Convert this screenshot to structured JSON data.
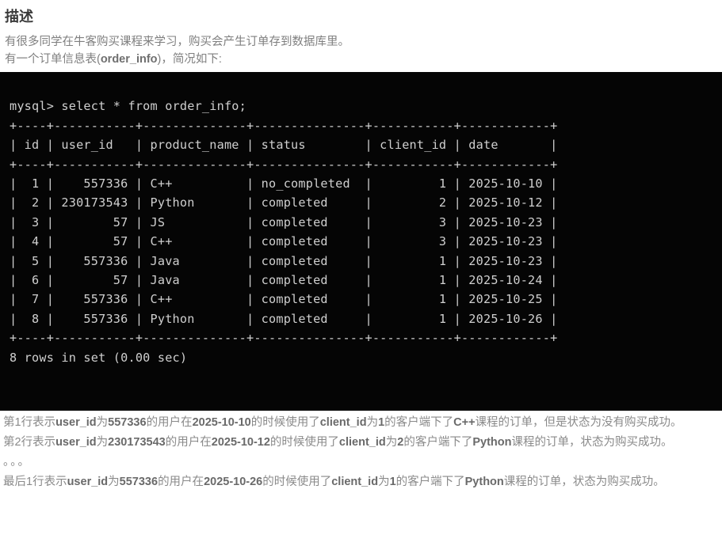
{
  "page": {
    "title": "描述"
  },
  "intro": {
    "line1": "有很多同学在牛客购买课程来学习，购买会产生订单存到数据库里。",
    "line2_prefix": "有一个订单信息表(",
    "line2_code": "order_info",
    "line2_suffix": ")，简况如下:"
  },
  "terminal": {
    "prompt_line": "mysql> select * from order_info;",
    "separator": "+----+-----------+--------------+---------------+-----------+------------+",
    "header": "| id | user_id   | product_name | status        | client_id | date       |",
    "rows": [
      "|  1 |    557336 | C++          | no_completed  |         1 | 2025-10-10 |",
      "|  2 | 230173543 | Python       | completed     |         2 | 2025-10-12 |",
      "|  3 |        57 | JS           | completed     |         3 | 2025-10-23 |",
      "|  4 |        57 | C++          | completed     |         3 | 2025-10-23 |",
      "|  5 |    557336 | Java         | completed     |         1 | 2025-10-23 |",
      "|  6 |        57 | Java         | completed     |         1 | 2025-10-24 |",
      "|  7 |    557336 | C++          | completed     |         1 | 2025-10-25 |",
      "|  8 |    557336 | Python       | completed     |         1 | 2025-10-26 |"
    ],
    "footer": "8 rows in set (0.00 sec)",
    "table": {
      "columns": [
        "id",
        "user_id",
        "product_name",
        "status",
        "client_id",
        "date"
      ],
      "data": [
        [
          "1",
          "557336",
          "C++",
          "no_completed",
          "1",
          "2025-10-10"
        ],
        [
          "2",
          "230173543",
          "Python",
          "completed",
          "2",
          "2025-10-12"
        ],
        [
          "3",
          "57",
          "JS",
          "completed",
          "3",
          "2025-10-23"
        ],
        [
          "4",
          "57",
          "C++",
          "completed",
          "3",
          "2025-10-23"
        ],
        [
          "5",
          "557336",
          "Java",
          "completed",
          "1",
          "2025-10-23"
        ],
        [
          "6",
          "57",
          "Java",
          "completed",
          "1",
          "2025-10-24"
        ],
        [
          "7",
          "557336",
          "C++",
          "completed",
          "1",
          "2025-10-25"
        ],
        [
          "8",
          "557336",
          "Python",
          "completed",
          "1",
          "2025-10-26"
        ]
      ]
    }
  },
  "notes": {
    "note1": {
      "p1": "第1行表示",
      "b1": "user_id",
      "p2": "为",
      "b2": "557336",
      "p3": "的用户在",
      "b3": "2025-10-10",
      "p4": "的时候使用了",
      "b4": "client_id",
      "p5": "为",
      "b5": "1",
      "p6": "的客户端下了",
      "b6": "C++",
      "p7": "课程的订单，但是状态为没有购买成功。"
    },
    "note2": {
      "p1": "第2行表示",
      "b1": "user_id",
      "p2": "为",
      "b2": "230173543",
      "p3": "的用户在",
      "b3": "2025-10-12",
      "p4": "的时候使用了",
      "b4": "client_id",
      "p5": "为",
      "b5": "2",
      "p6": "的客户端下了",
      "b6": "Python",
      "p7": "课程的订单，状态为购买成功。"
    },
    "ellipsis": "。。。",
    "note3": {
      "p1": "最后1行表示",
      "b1": "user_id",
      "p2": "为",
      "b2": "557336",
      "p3": "的用户在",
      "b3": "2025-10-26",
      "p4": "的时候使用了",
      "b4": "client_id",
      "p5": "为",
      "b5": "1",
      "p6": "的客户端下了",
      "b6": "Python",
      "p7": "课程的订单，状态为购买成功。"
    }
  }
}
